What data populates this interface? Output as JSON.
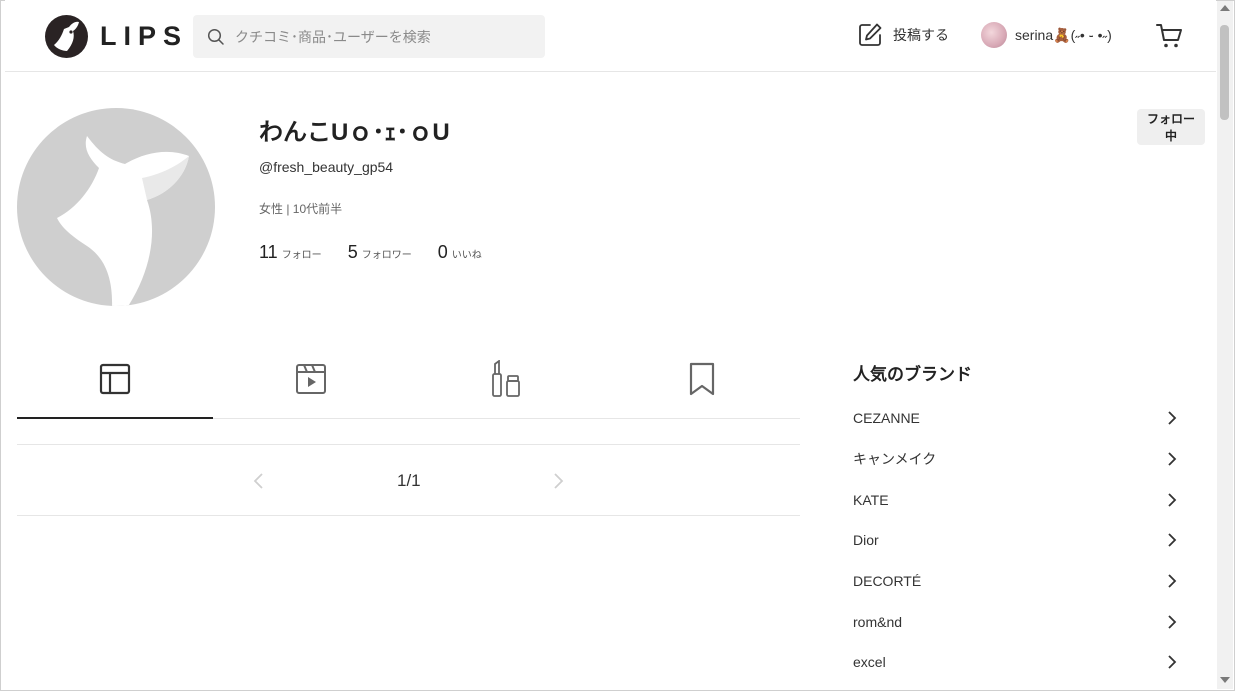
{
  "header": {
    "logo_text": "LIPS",
    "search_placeholder": "クチコミ･商品･ユーザーを検索",
    "post_label": "投稿する",
    "username": "serina🧸(˶• ֊ •˶)"
  },
  "profile": {
    "name": "わんこUｏ･ｪ･ｏU",
    "handle": "@fresh_beauty_gp54",
    "meta": "女性 | 10代前半",
    "stats": [
      {
        "num": "11",
        "label": "フォロー"
      },
      {
        "num": "5",
        "label": "フォロワー"
      },
      {
        "num": "0",
        "label": "いいね"
      }
    ],
    "follow_button": "フォロー中"
  },
  "tabs": [
    {
      "icon": "grid-icon",
      "active": true
    },
    {
      "icon": "video-icon",
      "active": false
    },
    {
      "icon": "cosmetics-icon",
      "active": false
    },
    {
      "icon": "bookmark-icon",
      "active": false
    }
  ],
  "pager": {
    "text": "1/1"
  },
  "sidebar": {
    "title": "人気のブランド",
    "brands": [
      "CEZANNE",
      "キャンメイク",
      "KATE",
      "Dior",
      "DECORTÉ",
      "rom&nd",
      "excel"
    ]
  },
  "colors": {
    "text": "#222222",
    "divider": "#e6e6e6",
    "avatar_bg": "#cfcfcf",
    "button_bg": "#efefef"
  }
}
